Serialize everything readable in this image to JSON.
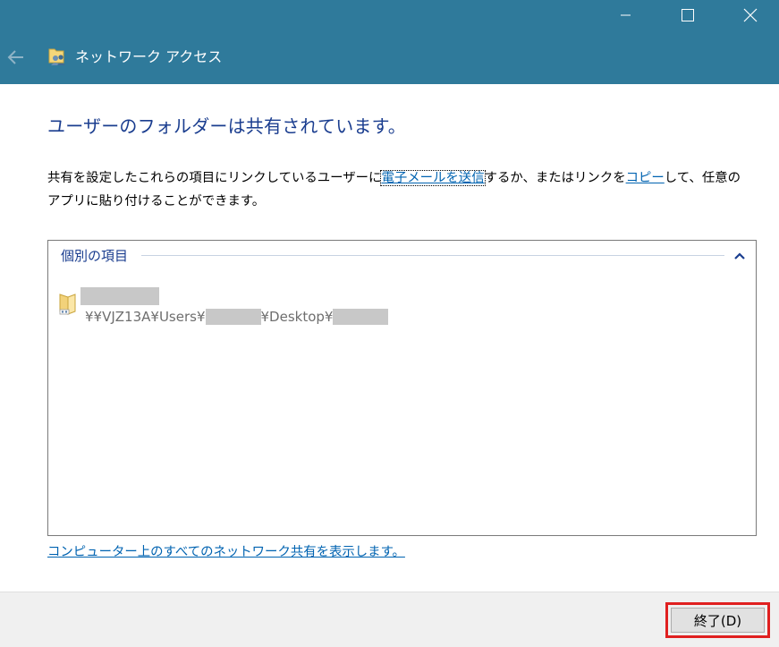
{
  "window": {
    "title": "ネットワーク アクセス",
    "titlebar_color": "#2f7a9b",
    "controls": {
      "minimize_icon": "minimize-icon",
      "maximize_icon": "maximize-icon",
      "close_icon": "close-icon"
    }
  },
  "nav": {
    "back_icon": "back-arrow-icon"
  },
  "main": {
    "heading": "ユーザーのフォルダーは共有されています。",
    "description": {
      "part1": "共有を設定したこれらの項目にリンクしているユーザーに",
      "email_link": "電子メールを送信",
      "part2": "するか、またはリンクを",
      "copy_link": "コピー",
      "part3": "して、任意の",
      "part4": "アプリに貼り付けることができます。"
    },
    "items_group": {
      "label": "個別の項目",
      "collapse_icon": "chevron-up-icon",
      "items": [
        {
          "icon": "folder-icon",
          "path_parts": [
            "¥¥VJZ13A¥Users¥",
            "¥Desktop¥"
          ]
        }
      ]
    },
    "all_shares_link": "コンピューター上のすべてのネットワーク共有を表示します。"
  },
  "footer": {
    "finish_button": "終了(D)"
  },
  "colors": {
    "heading": "#1a3d8f",
    "link": "#0063b1",
    "highlight": "#e02020"
  }
}
